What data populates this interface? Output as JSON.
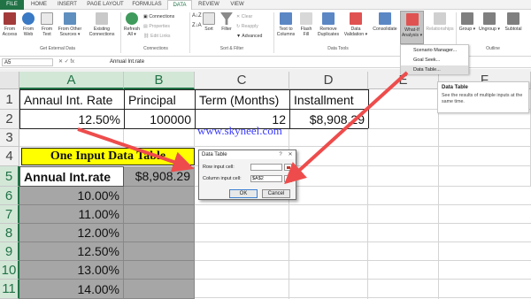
{
  "tabs": [
    {
      "label": "FILE"
    },
    {
      "label": "HOME"
    },
    {
      "label": "INSERT"
    },
    {
      "label": "PAGE LAYOUT"
    },
    {
      "label": "FORMULAS"
    },
    {
      "label": "DATA"
    },
    {
      "label": "REVIEW"
    },
    {
      "label": "VIEW"
    }
  ],
  "ribbon": {
    "from_access": "From Access",
    "from_web": "From Web",
    "from_text": "From Text",
    "from_other": "From Other Sources ▾",
    "existing": "Existing Connections",
    "get_external": "Get External Data",
    "refresh_all": "Refresh All ▾",
    "connections": "Connections",
    "properties": "Properties",
    "edit_links": "Edit Links",
    "connections_group": "Connections",
    "sort": "Sort",
    "filter": "Filter",
    "clear": "Clear",
    "reapply": "Reapply",
    "advanced": "Advanced",
    "sort_filter_group": "Sort & Filter",
    "text_to_columns": "Text to Columns",
    "flash_fill": "Flash Fill",
    "remove_duplicates": "Remove Duplicates",
    "data_validation": "Data Validation ▾",
    "consolidate": "Consolidate",
    "data_tools_group": "Data Tools",
    "what_if": "What-If Analysis ▾",
    "relationships": "Relationships",
    "group": "Group ▾",
    "ungroup": "Ungroup ▾",
    "subtotal": "Subtotal",
    "outline_group": "Outline"
  },
  "dropdown": {
    "items": [
      {
        "label": "Scenario Manager..."
      },
      {
        "label": "Goal Seek..."
      },
      {
        "label": "Data Table..."
      }
    ]
  },
  "tooltip": {
    "title": "Data Table",
    "desc": "See the results of multiple inputs at the same time."
  },
  "formula_bar": {
    "name_box": "A5",
    "fx": "✕ ✓ fx",
    "content": "Annual Int.rate"
  },
  "columns": [
    {
      "label": "A"
    },
    {
      "label": "B"
    },
    {
      "label": "C"
    },
    {
      "label": "D"
    },
    {
      "label": "E"
    },
    {
      "label": "F"
    }
  ],
  "rows": [
    "1",
    "2",
    "3",
    "4",
    "5",
    "6",
    "7",
    "8",
    "9",
    "10",
    "11"
  ],
  "cells": {
    "a1": "Annaul Int. Rate",
    "b1": "Principal",
    "c1": "Term (Months)",
    "d1": "Installment",
    "a2": "12.50%",
    "b2": "100000",
    "c2": "12",
    "d2": "$8,908.29",
    "a4": "One Input Data Table",
    "a5": "Annual Int.rate",
    "b5": "$8,908.29",
    "a6": "10.00%",
    "a7": "11.00%",
    "a8": "12.00%",
    "a9": "12.50%",
    "a10": "13.00%",
    "a11": "14.00%"
  },
  "watermark": "www.skyneel.com",
  "dialog": {
    "title": "Data Table",
    "help": "?",
    "close": "✕",
    "row_label": "Row input cell:",
    "col_label": "Column input cell:",
    "row_value": "",
    "col_value": "$A$2",
    "ok": "OK",
    "cancel": "Cancel"
  },
  "colors": {
    "excel_green": "#217346",
    "highlight_yellow": "#ffff00",
    "selection_gray": "#a6a6a6",
    "arrow_red": "#ee4c4c",
    "watermark_blue": "#3a3aff"
  }
}
